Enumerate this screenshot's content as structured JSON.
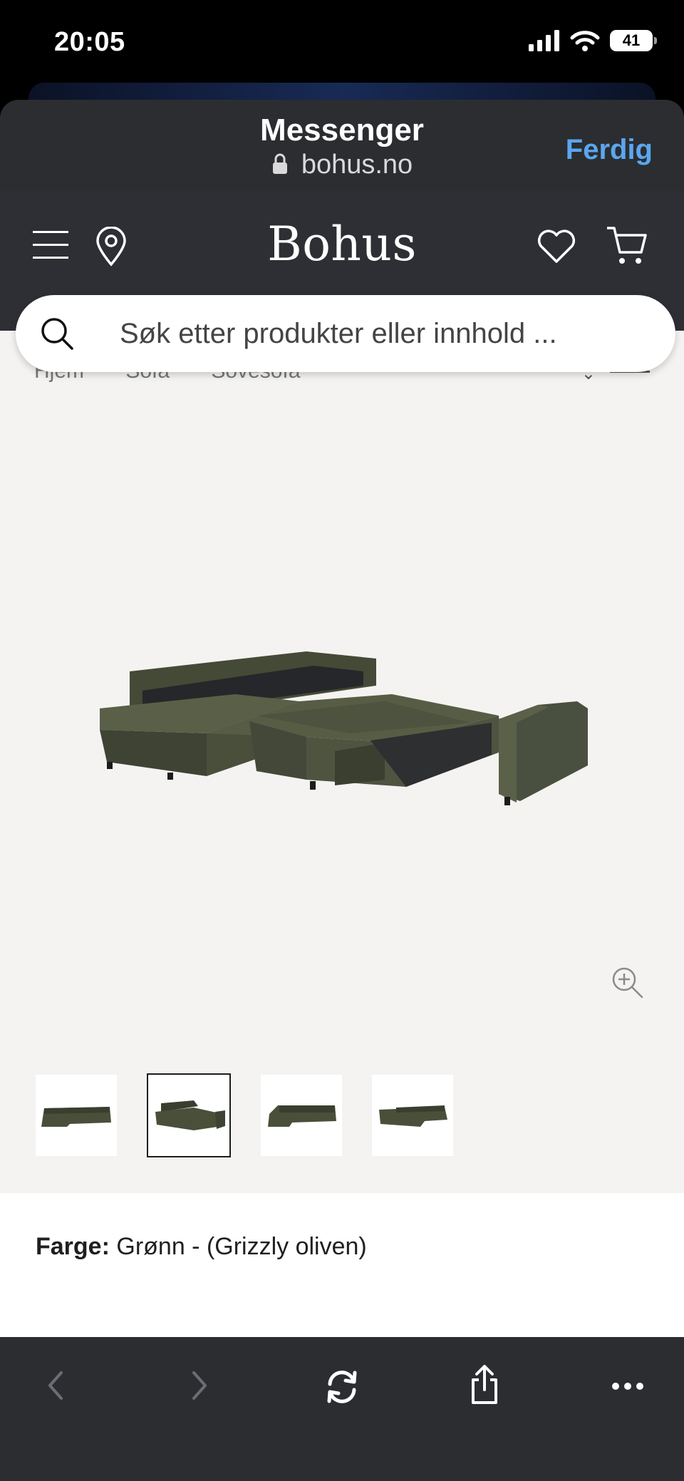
{
  "status_bar": {
    "time": "20:05",
    "battery": "41"
  },
  "sheet": {
    "title": "Messenger",
    "url": "bohus.no",
    "done_label": "Ferdig"
  },
  "site": {
    "logo": "Bohus"
  },
  "search": {
    "placeholder": "Søk etter produkter eller innhold ..."
  },
  "breadcrumb": [
    "Hjem",
    "Sofa",
    "Sovesofa"
  ],
  "product": {
    "color_label": "Farge:",
    "color_value": "Grønn - (Grizzly oliven)",
    "sofa_color": "#4a4f3a",
    "thumbnails": [
      "sofa-thumbnail-1",
      "sofa-thumbnail-2",
      "sofa-thumbnail-3",
      "sofa-thumbnail-4"
    ],
    "selected_thumbnail": 2
  },
  "colors": {
    "accent": "#5aa7ef",
    "header": "#2e2f35",
    "toolbar": "#2b2d31"
  }
}
